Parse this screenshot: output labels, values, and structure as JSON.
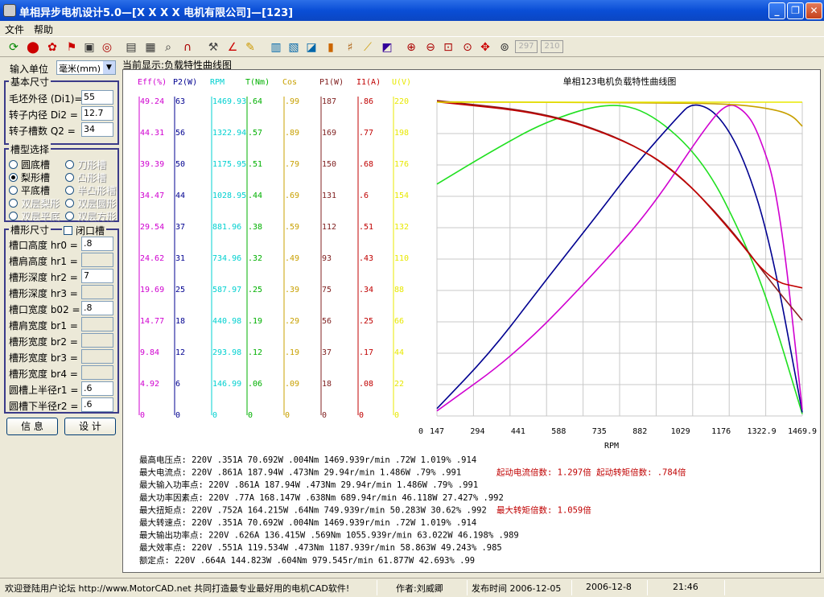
{
  "window": {
    "title": "单相异步电机设计5.0—[X X X X 电机有限公司]—[123]",
    "min": "_",
    "max": "❐",
    "close": "✕"
  },
  "menu": [
    "文件",
    "帮助"
  ],
  "toolbar": {
    "box1": "297",
    "box2": "210"
  },
  "units": {
    "label": "输入单位",
    "value": "毫米(mm)"
  },
  "basic": {
    "title": "基本尺寸",
    "rows": [
      {
        "label": "毛坯外径 (Di1)=",
        "value": "55"
      },
      {
        "label": "转子内径 Di2 =",
        "value": "12.7"
      },
      {
        "label": "转子槽数  Q2 =",
        "value": "34"
      }
    ]
  },
  "slottype": {
    "title": "槽型选择",
    "options": [
      "圆底槽",
      "刀形槽",
      "梨形槽",
      "凸形槽",
      "平底槽",
      "半凸形槽",
      "双层梨形",
      "双层圆形",
      "双层平底",
      "双层方形"
    ],
    "selected": 2
  },
  "slotsize": {
    "title": "槽形尺寸",
    "closed_label": "闭口槽",
    "rows": [
      {
        "label": "槽口高度 hr0 =",
        "value": ".8"
      },
      {
        "label": "槽肩高度 hr1 =",
        "value": ""
      },
      {
        "label": "槽形深度 hr2 =",
        "value": "7"
      },
      {
        "label": "槽形深度 hr3 =",
        "value": ""
      },
      {
        "label": "槽口宽度 b02 =",
        "value": ".8"
      },
      {
        "label": "槽肩宽度 br1 =",
        "value": ""
      },
      {
        "label": "槽形宽度 br2 =",
        "value": ""
      },
      {
        "label": "槽形宽度 br3 =",
        "value": ""
      },
      {
        "label": "槽形宽度 br4 =",
        "value": ""
      },
      {
        "label": "圆槽上半径r1 =",
        "value": ".6"
      },
      {
        "label": "圆槽下半径r2 =",
        "value": ".6"
      }
    ]
  },
  "buttons": {
    "info": "信  息",
    "design": "设  计"
  },
  "current_display": "当前显示:负载特性曲线图",
  "chart_data": {
    "type": "line",
    "title": "单相123电机负载特性曲线图",
    "xlabel": "RPM",
    "x_ticks": [
      "0",
      "147",
      "294",
      "441",
      "588",
      "735",
      "882",
      "1029",
      "1176",
      "1322.9",
      "1469.9"
    ],
    "xlim": [
      0,
      1469.9
    ],
    "axes": [
      {
        "name": "Eff(%)",
        "color": "#d000d0",
        "ticks": [
          "49.24",
          "44.31",
          "39.39",
          "34.47",
          "29.54",
          "24.62",
          "19.69",
          "14.77",
          "9.84",
          "4.92",
          "0"
        ]
      },
      {
        "name": "P2(W)",
        "color": "#000090",
        "ticks": [
          "63",
          "56",
          "50",
          "44",
          "37",
          "31",
          "25",
          "18",
          "12",
          "6",
          "0"
        ]
      },
      {
        "name": "RPM",
        "color": "#00d0d0",
        "ticks": [
          "1469.93",
          "1322.94",
          "1175.95",
          "1028.95",
          "881.96",
          "734.96",
          "587.97",
          "440.98",
          "293.98",
          "146.99",
          "0"
        ]
      },
      {
        "name": "T(Nm)",
        "color": "#00b000",
        "ticks": [
          ".64",
          ".57",
          ".51",
          ".44",
          ".38",
          ".32",
          ".25",
          ".19",
          ".12",
          ".06",
          "0"
        ]
      },
      {
        "name": "Cos",
        "color": "#c8a000",
        "ticks": [
          ".99",
          ".89",
          ".79",
          ".69",
          ".59",
          ".49",
          ".39",
          ".29",
          ".19",
          ".09",
          "0"
        ]
      },
      {
        "name": "P1(W)",
        "color": "#802020",
        "ticks": [
          "187",
          "169",
          "150",
          "131",
          "112",
          "93",
          "75",
          "56",
          "37",
          "18",
          "0"
        ]
      },
      {
        "name": "I1(A)",
        "color": "#c00000",
        "ticks": [
          ".86",
          ".77",
          ".68",
          ".6",
          ".51",
          ".43",
          ".34",
          ".25",
          ".17",
          ".08",
          "0"
        ]
      },
      {
        "name": "U(V)",
        "color": "#e8e800",
        "ticks": [
          "220",
          "198",
          "176",
          "154",
          "132",
          "110",
          "88",
          "66",
          "44",
          "22",
          "0"
        ]
      }
    ],
    "series": [
      {
        "name": "T(Nm)",
        "color": "#20e020",
        "x": [
          94,
          300,
          500,
          735,
          900,
          1100,
          1250,
          1350,
          1469.9
        ],
        "y": [
          0.473,
          0.54,
          0.6,
          0.64,
          0.62,
          0.52,
          0.36,
          0.22,
          0.004
        ]
      },
      {
        "name": "P2(W)",
        "color": "#000090",
        "x": [
          94,
          300,
          500,
          700,
          850,
          1000,
          1056,
          1150,
          1250,
          1350,
          1469.9
        ],
        "y": [
          1.486,
          13,
          27,
          40.5,
          51,
          60,
          63.022,
          61,
          52,
          35,
          0.72
        ]
      },
      {
        "name": "Eff(%)",
        "color": "#d000d0",
        "x": [
          94,
          400,
          700,
          900,
          1100,
          1187,
          1250,
          1300,
          1380,
          1469.9
        ],
        "y": [
          0.79,
          10,
          23,
          32.5,
          45,
          49.243,
          48,
          45,
          35,
          1.019
        ]
      },
      {
        "name": "Cos",
        "color": "#c8a000",
        "x": [
          94,
          500,
          900,
          1200,
          1350,
          1430,
          1469.9
        ],
        "y": [
          0.991,
          0.99,
          0.988,
          0.985,
          0.97,
          0.95,
          0.914
        ]
      },
      {
        "name": "P1(W)",
        "color": "#8b2020",
        "x": [
          94,
          500,
          800,
          1000,
          1200,
          1350,
          1469.9
        ],
        "y": [
          187.94,
          181,
          165,
          145,
          112,
          80,
          57
        ]
      },
      {
        "name": "I1(A)",
        "color": "#c00000",
        "x": [
          94,
          500,
          800,
          1000,
          1200,
          1350,
          1469.9
        ],
        "y": [
          0.861,
          0.83,
          0.757,
          0.67,
          0.51,
          0.37,
          0.351
        ]
      },
      {
        "name": "U(V)",
        "color": "#e8e800",
        "x": [
          94,
          1469.9
        ],
        "y": [
          220,
          220
        ]
      }
    ]
  },
  "results": [
    {
      "text": "最高电压点: 220V .351A 70.692W .004Nm  1469.939r/min  .72W 1.019% .914",
      "extra": ""
    },
    {
      "text": "最大电流点: 220V .861A 187.94W .473Nm  29.94r/min  1.486W .79% .991",
      "extra": "起动电流倍数: 1.297倍   起动转矩倍数: .784倍"
    },
    {
      "text": "最大输入功率点: 220V .861A 187.94W .473Nm  29.94r/min  1.486W .79% .991",
      "extra": ""
    },
    {
      "text": "最大功率因素点: 220V .77A 168.147W .638Nm  689.94r/min  46.118W 27.427% .992",
      "extra": ""
    },
    {
      "text": "最大扭矩点: 220V .752A 164.215W .64Nm  749.939r/min  50.283W 30.62% .992",
      "extra": "最大转矩倍数: 1.059倍"
    },
    {
      "text": "最大转速点: 220V .351A 70.692W .004Nm  1469.939r/min  .72W 1.019% .914",
      "extra": ""
    },
    {
      "text": "最大输出功率点: 220V .626A 136.415W .569Nm  1055.939r/min  63.022W 46.198% .989",
      "extra": ""
    },
    {
      "text": "最大效率点: 220V .551A 119.534W .473Nm  1187.939r/min  58.863W 49.243% .985",
      "extra": ""
    },
    {
      "text": "额定点: 220V .664A 144.823W .604Nm  979.545r/min  61.877W 42.693% .99",
      "extra": ""
    }
  ],
  "status": {
    "forum": "欢迎登陆用户论坛 http://www.MotorCAD.net 共同打造最专业最好用的电机CAD软件!",
    "author": "作者:刘威卿",
    "release": "发布时间 2006-12-05",
    "date": "2006-12-8",
    "time": "21:46"
  }
}
